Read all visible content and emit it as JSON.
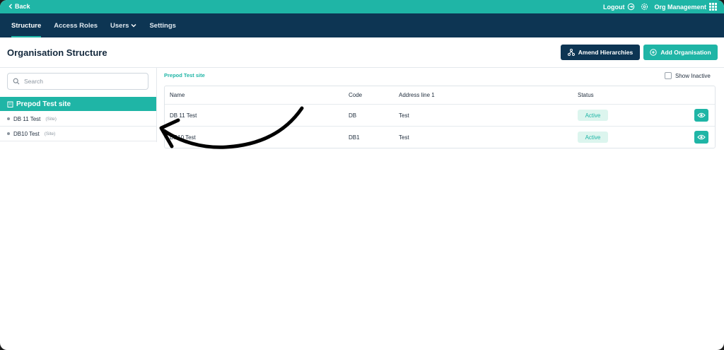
{
  "topbar": {
    "back_label": "Back",
    "logout_label": "Logout",
    "app_label": "Org Management",
    "brand_color": "#1fb5a6"
  },
  "nav": {
    "tabs": [
      {
        "label": "Structure",
        "active": true
      },
      {
        "label": "Access Roles",
        "active": false
      },
      {
        "label": "Users",
        "active": false
      },
      {
        "label": "Settings",
        "active": false
      }
    ],
    "bg_color": "#0d3553"
  },
  "header": {
    "title": "Organisation Structure",
    "amend_button": "Amend Hierarchies",
    "add_button": "Add Organisation"
  },
  "sidebar": {
    "search_placeholder": "Search",
    "root_label": "Prepod Test site",
    "items": [
      {
        "name": "DB 11 Test",
        "type": "(Site)"
      },
      {
        "name": "DB10 Test",
        "type": "(Site)"
      }
    ]
  },
  "main": {
    "breadcrumb": "Prepod Test site",
    "show_inactive_label": "Show Inactive",
    "show_inactive_checked": false,
    "columns": [
      "Name",
      "Code",
      "Address line 1",
      "Status"
    ],
    "rows": [
      {
        "name": "DB 11 Test",
        "code": "DB",
        "address": "Test",
        "status": "Active"
      },
      {
        "name": "DB10 Test",
        "code": "DB1",
        "address": "Test",
        "status": "Active"
      }
    ]
  },
  "icons": {
    "back": "chevron-left-icon",
    "logout": "logout-icon",
    "settings": "gear-icon",
    "apps": "grid-icon",
    "hierarchy": "hierarchy-icon",
    "add": "plus-circle-icon",
    "search": "search-icon",
    "building": "building-icon",
    "view": "eye-icon"
  }
}
